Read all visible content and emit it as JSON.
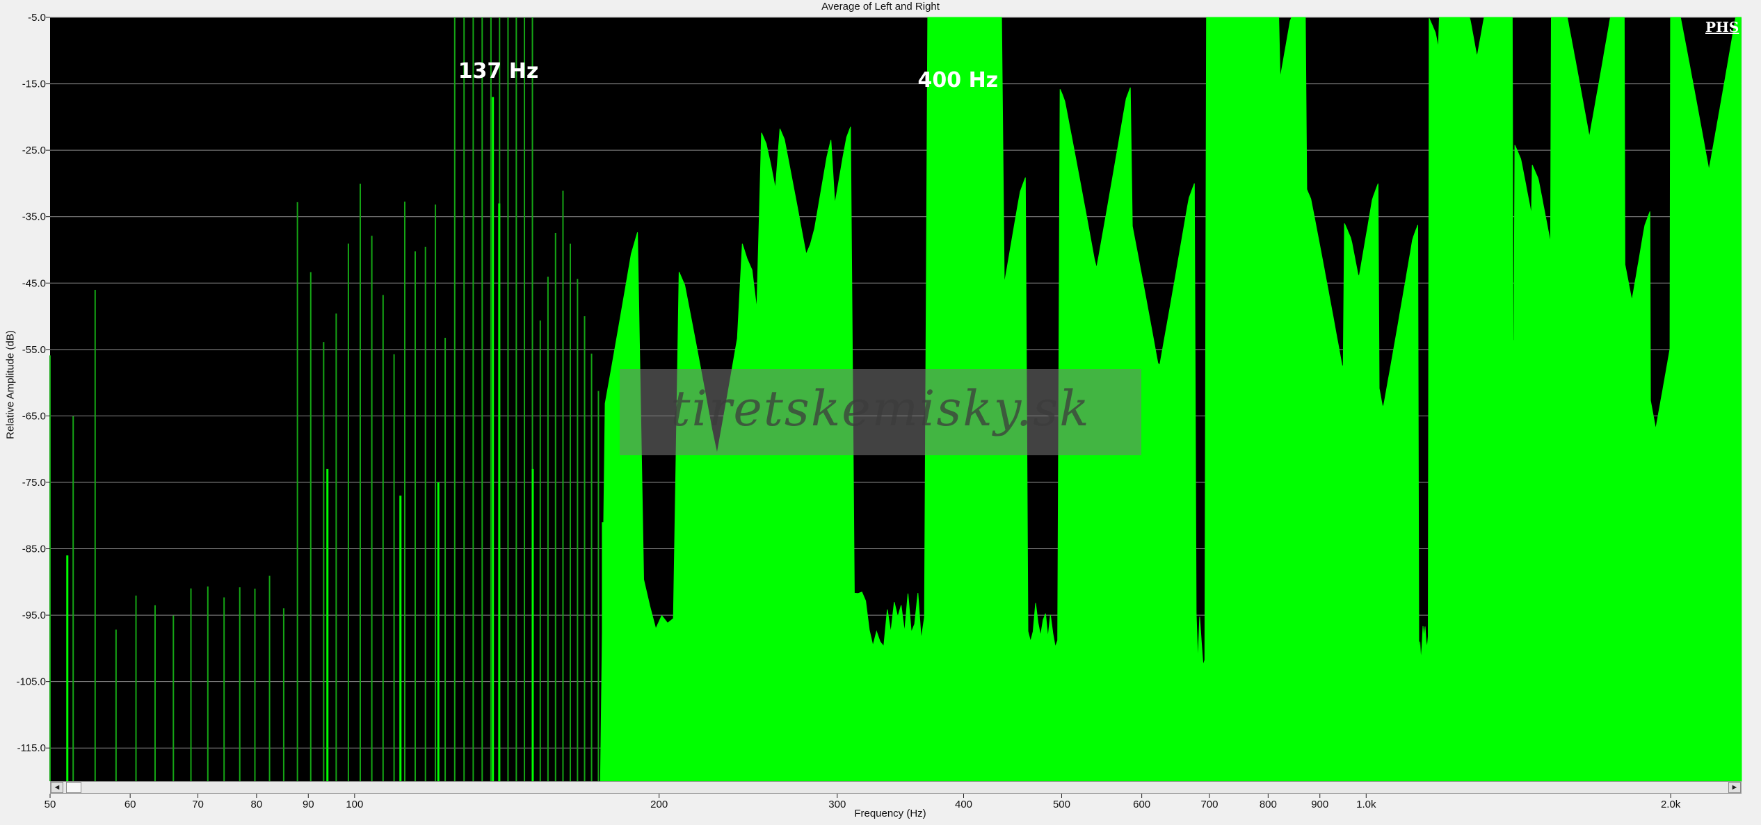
{
  "chart_data": {
    "type": "area",
    "title": "Average of Left and Right",
    "xlabel": "Frequency (Hz)",
    "ylabel": "Relative Amplitude (dB)",
    "x_scale": "log",
    "xlim": [
      50,
      2350
    ],
    "ylim": [
      -120,
      -5
    ],
    "y_ticks": [
      -5.0,
      -15.0,
      -25.0,
      -35.0,
      -45.0,
      -55.0,
      -65.0,
      -75.0,
      -85.0,
      -95.0,
      -105.0,
      -115.0
    ],
    "y_tick_labels": [
      "-5.0",
      "-15.0",
      "-25.0",
      "-35.0",
      "-45.0",
      "-55.0",
      "-65.0",
      "-75.0",
      "-85.0",
      "-95.0",
      "-105.0",
      "-115.0"
    ],
    "x_ticks": [
      50,
      60,
      70,
      80,
      90,
      100,
      200,
      300,
      400,
      500,
      600,
      700,
      800,
      900,
      1000,
      2000
    ],
    "x_tick_labels": [
      "50",
      "60",
      "70",
      "80",
      "90",
      "100",
      "200",
      "300",
      "400",
      "500",
      "600",
      "700",
      "800",
      "900",
      "1.0k",
      "2.0k"
    ],
    "grid": true,
    "background": "#000000",
    "series": [
      {
        "color": "#00ff00",
        "noise_floor": [
          [
            50,
            -98
          ],
          [
            60,
            -96
          ],
          [
            80,
            -94
          ],
          [
            100,
            -92
          ],
          [
            130,
            -89
          ],
          [
            150,
            -90
          ],
          [
            200,
            -96
          ],
          [
            300,
            -97
          ],
          [
            400,
            -97
          ],
          [
            500,
            -99
          ],
          [
            700,
            -101
          ],
          [
            1000,
            -102
          ],
          [
            1500,
            -104
          ],
          [
            2000,
            -108
          ],
          [
            2350,
            -110
          ]
        ],
        "peaks": [
          {
            "x": 52,
            "y": -86
          },
          {
            "x": 94,
            "y": -73
          },
          {
            "x": 111,
            "y": -77
          },
          {
            "x": 121,
            "y": -75
          },
          {
            "x": 137,
            "y": -17
          },
          {
            "x": 139,
            "y": -33
          },
          {
            "x": 150,
            "y": -73
          },
          {
            "x": 176,
            "y": -81
          },
          {
            "x": 228,
            "y": -87
          },
          {
            "x": 262,
            "y": -82
          },
          {
            "x": 275,
            "y": -66
          },
          {
            "x": 286,
            "y": -65
          },
          {
            "x": 400,
            "y": -18
          },
          {
            "x": 404,
            "y": -23
          },
          {
            "x": 425,
            "y": -73
          },
          {
            "x": 541,
            "y": -59
          },
          {
            "x": 624,
            "y": -74
          },
          {
            "x": 757,
            "y": -26
          },
          {
            "x": 805,
            "y": -38
          },
          {
            "x": 948,
            "y": -74
          },
          {
            "x": 1039,
            "y": -80
          },
          {
            "x": 1259,
            "y": -49
          },
          {
            "x": 1287,
            "y": -27
          },
          {
            "x": 1372,
            "y": -77
          },
          {
            "x": 1529,
            "y": -68
          },
          {
            "x": 1591,
            "y": -71
          },
          {
            "x": 1662,
            "y": -39
          },
          {
            "x": 1762,
            "y": -78
          },
          {
            "x": 1933,
            "y": -83
          },
          {
            "x": 2182,
            "y": -44
          }
        ]
      }
    ],
    "annotations": [
      {
        "text": "137 Hz",
        "x": 137
      },
      {
        "text": "400 Hz",
        "x": 400
      }
    ]
  },
  "brand": "PHS",
  "watermark": "tiretskemisky.sk",
  "scrollbar": {
    "left_arrow": "◄",
    "right_arrow": "►"
  }
}
